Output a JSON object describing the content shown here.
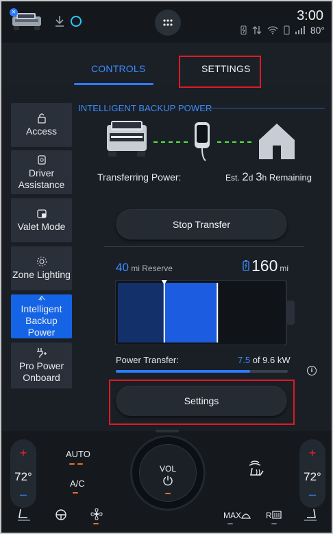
{
  "status": {
    "time": "3:00",
    "outside_temp": "80°",
    "icons": [
      "vehicle-icon",
      "bluetooth-badge-icon",
      "download-icon",
      "alexa-icon",
      "apps-grid-icon",
      "phone-charge-icon",
      "data-arrows-icon",
      "wifi-icon",
      "phone-icon",
      "signal-icon"
    ]
  },
  "tabs": [
    {
      "label": "CONTROLS",
      "active": true
    },
    {
      "label": "SETTINGS",
      "active": false
    }
  ],
  "sidebar": {
    "items": [
      {
        "label": "Access",
        "icon": "lock-icon",
        "active": false
      },
      {
        "label": "Driver Assistance",
        "icon": "driver-assist-icon",
        "active": false
      },
      {
        "label": "Valet Mode",
        "icon": "valet-lock-icon",
        "active": false
      },
      {
        "label": "Zone Lighting",
        "icon": "zone-lighting-icon",
        "active": false
      },
      {
        "label": "Intelligent Backup Power",
        "icon": "backup-power-icon",
        "active": true
      },
      {
        "label": "Pro Power Onboard",
        "icon": "pro-power-icon",
        "active": false
      }
    ]
  },
  "backup": {
    "title": "INTELLIGENT BACKUP POWER",
    "transferring_label": "Transferring Power:",
    "est_prefix": "Est.",
    "days": "2",
    "days_unit": "d",
    "hours": "3",
    "hours_unit": "h",
    "remaining_label": "Remaining",
    "stop_button": "Stop Transfer",
    "reserve_value": "40",
    "reserve_unit": "mi Reserve",
    "range_value": "160",
    "range_unit": "mi",
    "battery_fill_fraction": 0.6,
    "reserve_fraction": 0.28,
    "power_transfer_label": "Power Transfer:",
    "power_current": "7.5",
    "power_of": "of 9.6 kW",
    "power_fraction": 0.78,
    "settings_button": "Settings"
  },
  "climate": {
    "left_temp": "72°",
    "right_temp": "72°",
    "plus": "+",
    "minus": "–",
    "auto_label": "AUTO",
    "ac_label": "A/C",
    "vol_label": "VOL",
    "max_label": "MAX",
    "rear_label": "R",
    "icons": [
      "seat-heat-left-icon",
      "steering-heat-icon",
      "fan-icon",
      "heated-seat-driver-icon",
      "max-defrost-icon",
      "rear-defrost-icon",
      "seat-heat-right-icon"
    ]
  },
  "colors": {
    "accent": "#2d7bff",
    "highlight": "#e01a22",
    "active_sidebar": "#1564e6",
    "heat": "#e0262d"
  }
}
